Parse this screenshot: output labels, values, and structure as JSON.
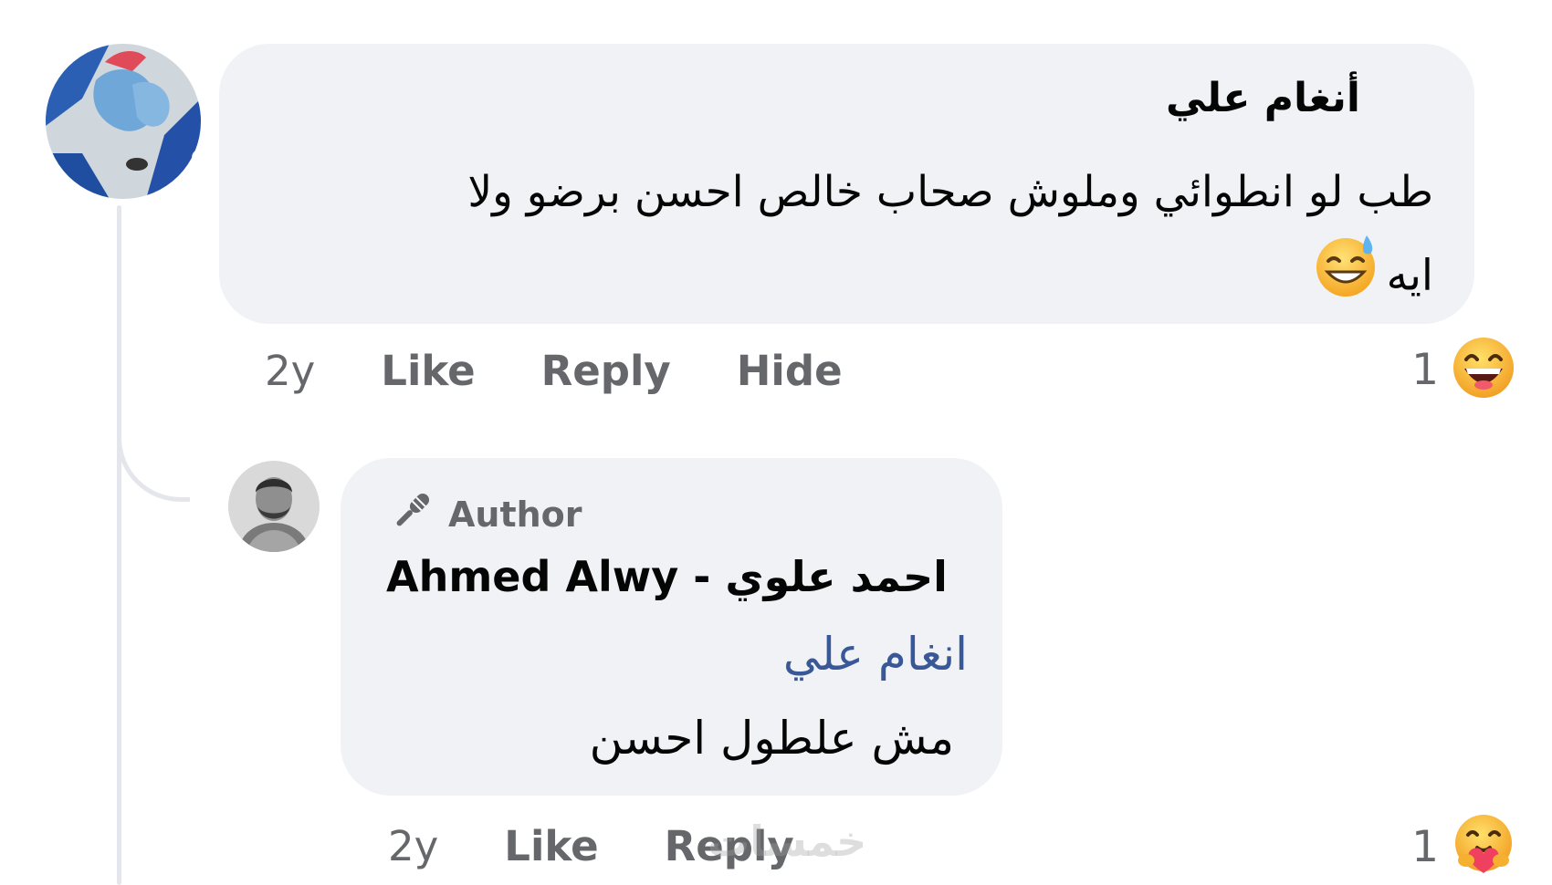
{
  "comment": {
    "author": "أنغام علي",
    "text_line_1": "طب لو انطوائي وملوش صحاب خالص احسن برضو ولا",
    "text_line_2": "ايه",
    "text_emoji": "sweat-smile-emoji",
    "time": "2y",
    "actions": [
      "Like",
      "Reply",
      "Hide"
    ],
    "reaction": {
      "count": "1",
      "icon": "laughing-face-emoji"
    }
  },
  "reply": {
    "badge": "Author",
    "badge_icon": "microphone-icon",
    "author": "Ahmed Alwy - احمد علوي",
    "mention": "انغام علي",
    "text": "مش علطول احسن",
    "time": "2y",
    "actions": [
      "Like",
      "Reply"
    ],
    "reaction": {
      "count": "1",
      "icon": "care-hug-emoji"
    }
  },
  "watermark": "خمسات",
  "colors": {
    "bubble": "#f0f2f5",
    "secondary_text": "#65676b",
    "mention": "#385898",
    "thread_line": "#e4e6eb"
  }
}
